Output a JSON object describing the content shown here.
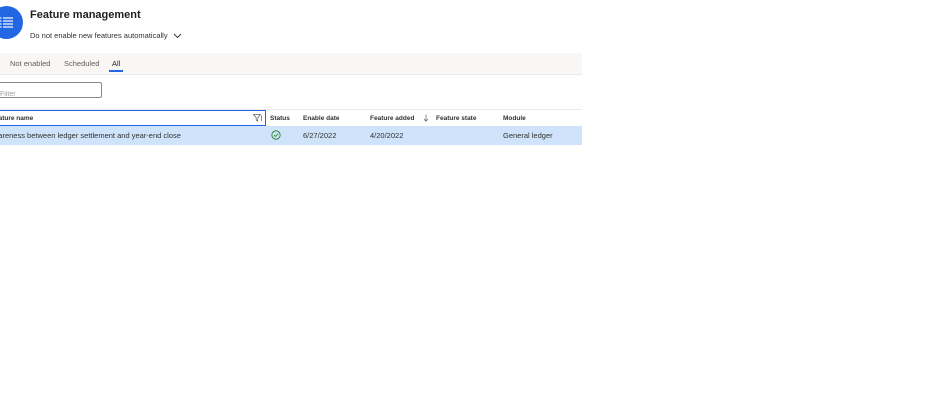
{
  "header": {
    "title": "Feature management",
    "subtitle": "Do not enable new features automatically",
    "icon": "list-icon",
    "accent_color": "#2266e3"
  },
  "tabs": [
    {
      "label": "Not enabled",
      "active": false
    },
    {
      "label": "Scheduled",
      "active": false
    },
    {
      "label": "All",
      "active": true
    }
  ],
  "filter": {
    "placeholder": "Filter",
    "value": ""
  },
  "grid": {
    "columns": {
      "feature_name": "Feature name",
      "status": "Status",
      "enable_date": "Enable date",
      "feature_added": "Feature added",
      "feature_state": "Feature state",
      "module": "Module"
    },
    "rows": [
      {
        "feature_name": "Awareness between ledger settlement and year-end close",
        "status": "enabled",
        "enable_date": "6/27/2022",
        "feature_added": "4/20/2022",
        "feature_state": "",
        "module": "General ledger",
        "selected": true
      }
    ]
  },
  "colors": {
    "selected_row": "#cfe4fa",
    "status_ok": "#107c10",
    "tab_bar": "#f8f7f6"
  }
}
